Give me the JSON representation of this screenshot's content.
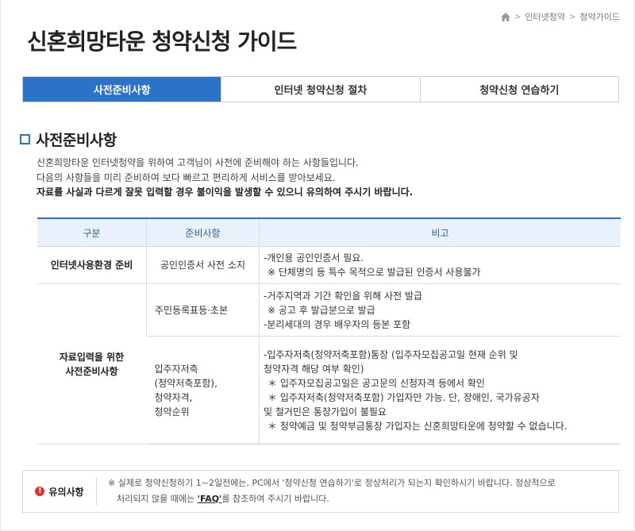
{
  "breadcrumb": {
    "home_icon": "home-icon",
    "items": [
      "인터넷청약",
      "청약가이드"
    ],
    "separator": ">"
  },
  "page_title": "신혼희망타운 청약신청 가이드",
  "tabs": [
    {
      "label": "사전준비사항",
      "active": true
    },
    {
      "label": "인터넷 청약신청 절차",
      "active": false
    },
    {
      "label": "청약신청 연습하기",
      "active": false
    }
  ],
  "section": {
    "title": "사전준비사항",
    "icon": "square-bullet-icon"
  },
  "intro": {
    "line1": "신혼희망타운 인터넷청약을 위하여 고객님이 사전에 준비해야 하는 사항들입니다.",
    "line2": "다음의 사항들을 미리 준비하여 보다 빠르고 편리하게 서비스를 받아보세요.",
    "line3": "자료를 사실과 다르게 잘못 입력할 경우 불이익을 발생할 수 있으니 유의하여 주시기 바랍니다."
  },
  "table": {
    "headers": [
      "구분",
      "준비사항",
      "비고"
    ],
    "cat1": "인터넷사용환경 준비",
    "cat2_line1": "자료입력을 위한",
    "cat2_line2": "사전준비사항",
    "row1": {
      "prep": "공인인증서 사전 소지",
      "note1": "-개인용 공인인증서 필요.",
      "note2": "※ 단체명의 등 특수 목적으로 발급된 인증서 사용불가"
    },
    "row2": {
      "prep": "주민등록표등·초본",
      "note1": "-거주지역과 기간 확인을 위해 사전 발급",
      "note2": "※ 공고 후 발급분으로 발급",
      "note3": "-분리세대의 경우 배우자의 등본 포함"
    },
    "row3": {
      "prep1": "입주자저축",
      "prep2": "(청약저축포함),",
      "prep3": "청약자격,",
      "prep4": "청약순위",
      "note1": "-입주자저축(청약저축포함)통장 (입주자모집공고일 현재 순위 및",
      "note2": "청약자격 해당 여부 확인)",
      "note3": "＊ 입주자모집공고일은 공고문의 신청자격 등에서 확인",
      "note4": "＊ 입주자저축(청약저축포함) 가입자만 가능. 단, 장애인, 국가유공자",
      "note5": "및 철거민은 통장가입이 불필요",
      "note6": "＊ 청약예금 및 청약부금통장 가입자는 신혼희망타운에 청약할 수 없습니다."
    }
  },
  "notice": {
    "label": "유의사항",
    "icon": "alert-circle-icon",
    "line1": "※ 실제로 청약신청하기 1~2일전에는, PC에서 '청약신청 연습하기'로 정상처리가 되는지 확인하시기 바랍니다. 정상적으로",
    "line2_prefix": "처리되지 않을 때에는 ",
    "faq_link": "'FAQ'",
    "line2_suffix": "를 참조하여 주시기 바랍니다."
  },
  "colors": {
    "accent": "#2b73c9",
    "table_header_bg": "#e9f1fb",
    "alert": "#e0312c"
  }
}
